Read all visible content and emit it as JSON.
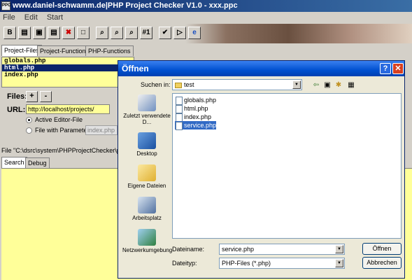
{
  "app": {
    "title": "www.daniel-schwamm.de|PHP Project Checker V1.0 - xxx.ppc",
    "icon_text": "PPC",
    "menu": [
      "File",
      "Edit",
      "Start"
    ],
    "toolbar_glyphs": [
      "B",
      "▤",
      "▣",
      "▤",
      "✖",
      "□",
      "⌕",
      "⌕",
      "⌕",
      "#1",
      "✔",
      "▷",
      "e"
    ]
  },
  "project_tabs": [
    "Project-Files",
    "Project-Functions",
    "PHP-Functions"
  ],
  "project_files": [
    "globals.php",
    "html.php",
    "index.php"
  ],
  "selected_file_index": 1,
  "files_label": "Files:",
  "files_buttons": [
    "+",
    "-"
  ],
  "url_label": "URL:",
  "url_value": "http://localhost/projects/",
  "radio_active_editor": "Active Editor-File",
  "radio_with_param": "File with Parameter:",
  "param_value": "index.php",
  "path_text": "File \"C:\\dsrc\\system\\PHPProjectChecker\\proje",
  "bottom_tabs": [
    "Search",
    "Debug"
  ],
  "dialog": {
    "title": "Öffnen",
    "help_glyph": "?",
    "close_glyph": "✕",
    "look_in_label": "Suchen in:",
    "look_in_value": "test",
    "places": [
      "Zuletzt verwendete D...",
      "Desktop",
      "Eigene Dateien",
      "Arbeitsplatz",
      "Netzwerkumgebung"
    ],
    "files": [
      "globals.php",
      "html.php",
      "index.php",
      "service.php"
    ],
    "selected_index": 3,
    "filename_label": "Dateiname:",
    "filename_value": "service.php",
    "filetype_label": "Dateityp:",
    "filetype_value": "PHP-Files (*.php)",
    "open_button": "Öffnen",
    "cancel_button": "Abbrechen"
  }
}
